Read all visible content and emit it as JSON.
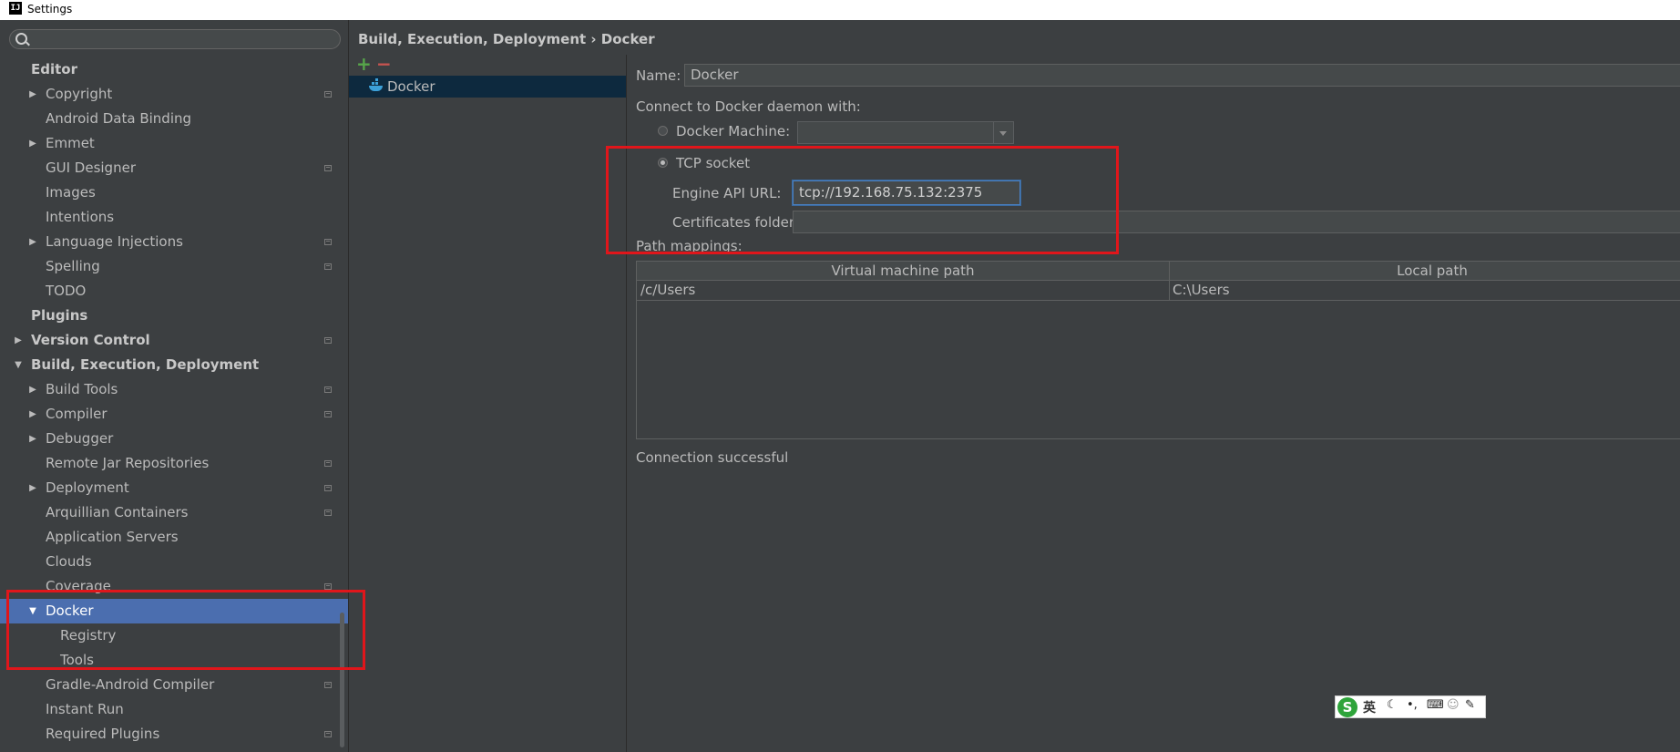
{
  "window": {
    "title": "Settings",
    "app_icon": "IJ"
  },
  "sidebar": {
    "search_placeholder": "",
    "items": [
      {
        "label": "Editor",
        "level": 0,
        "bold": true,
        "arrow": "",
        "project_icon": false
      },
      {
        "label": "Copyright",
        "level": 1,
        "bold": false,
        "arrow": "▶",
        "project_icon": true
      },
      {
        "label": "Android Data Binding",
        "level": 1,
        "bold": false,
        "arrow": "",
        "project_icon": false
      },
      {
        "label": "Emmet",
        "level": 1,
        "bold": false,
        "arrow": "▶",
        "project_icon": false
      },
      {
        "label": "GUI Designer",
        "level": 1,
        "bold": false,
        "arrow": "",
        "project_icon": true
      },
      {
        "label": "Images",
        "level": 1,
        "bold": false,
        "arrow": "",
        "project_icon": false
      },
      {
        "label": "Intentions",
        "level": 1,
        "bold": false,
        "arrow": "",
        "project_icon": false
      },
      {
        "label": "Language Injections",
        "level": 1,
        "bold": false,
        "arrow": "▶",
        "project_icon": true
      },
      {
        "label": "Spelling",
        "level": 1,
        "bold": false,
        "arrow": "",
        "project_icon": true
      },
      {
        "label": "TODO",
        "level": 1,
        "bold": false,
        "arrow": "",
        "project_icon": false
      },
      {
        "label": "Plugins",
        "level": 0,
        "bold": true,
        "arrow": "",
        "project_icon": false
      },
      {
        "label": "Version Control",
        "level": 0,
        "bold": true,
        "arrow": "▶",
        "project_icon": true
      },
      {
        "label": "Build, Execution, Deployment",
        "level": 0,
        "bold": true,
        "arrow": "▼",
        "project_icon": false
      },
      {
        "label": "Build Tools",
        "level": 1,
        "bold": false,
        "arrow": "▶",
        "project_icon": true
      },
      {
        "label": "Compiler",
        "level": 1,
        "bold": false,
        "arrow": "▶",
        "project_icon": true
      },
      {
        "label": "Debugger",
        "level": 1,
        "bold": false,
        "arrow": "▶",
        "project_icon": false
      },
      {
        "label": "Remote Jar Repositories",
        "level": 1,
        "bold": false,
        "arrow": "",
        "project_icon": true
      },
      {
        "label": "Deployment",
        "level": 1,
        "bold": false,
        "arrow": "▶",
        "project_icon": true
      },
      {
        "label": "Arquillian Containers",
        "level": 1,
        "bold": false,
        "arrow": "",
        "project_icon": true
      },
      {
        "label": "Application Servers",
        "level": 1,
        "bold": false,
        "arrow": "",
        "project_icon": false
      },
      {
        "label": "Clouds",
        "level": 1,
        "bold": false,
        "arrow": "",
        "project_icon": false
      },
      {
        "label": "Coverage",
        "level": 1,
        "bold": false,
        "arrow": "",
        "project_icon": true
      },
      {
        "label": "Docker",
        "level": 1,
        "bold": false,
        "arrow": "▼",
        "project_icon": false,
        "selected": true
      },
      {
        "label": "Registry",
        "level": 2,
        "bold": false,
        "arrow": "",
        "project_icon": false
      },
      {
        "label": "Tools",
        "level": 2,
        "bold": false,
        "arrow": "",
        "project_icon": false
      },
      {
        "label": "Gradle-Android Compiler",
        "level": 1,
        "bold": false,
        "arrow": "",
        "project_icon": true
      },
      {
        "label": "Instant Run",
        "level": 1,
        "bold": false,
        "arrow": "",
        "project_icon": false
      },
      {
        "label": "Required Plugins",
        "level": 1,
        "bold": false,
        "arrow": "",
        "project_icon": true
      }
    ]
  },
  "breadcrumb": "Build, Execution, Deployment › Docker",
  "list": {
    "add": "+",
    "remove": "−",
    "items": [
      "Docker"
    ]
  },
  "form": {
    "name_label": "Name:",
    "name_value": "Docker",
    "connect_label": "Connect to Docker daemon with:",
    "docker_machine_label": "Docker Machine:",
    "docker_machine_value": "",
    "tcp_label": "TCP socket",
    "engine_url_label": "Engine API URL:",
    "engine_url_value": "tcp://192.168.75.132:2375",
    "certs_label": "Certificates folder:",
    "certs_value": "",
    "path_mappings_label": "Path mappings:",
    "table_headers": [
      "Virtual machine path",
      "Local path"
    ],
    "rows": [
      [
        "/c/Users",
        "C:\\Users"
      ]
    ],
    "status": "Connection successful"
  },
  "ime": {
    "logo": "S",
    "lang": "英",
    "icons": [
      "moon-icon",
      "punctuation-icon",
      "keyboard-icon",
      "user-icon",
      "wrench-icon"
    ]
  },
  "colors": {
    "selection": "#4b6eaf",
    "highlight": "#e0161b",
    "background": "#3c3f41"
  }
}
